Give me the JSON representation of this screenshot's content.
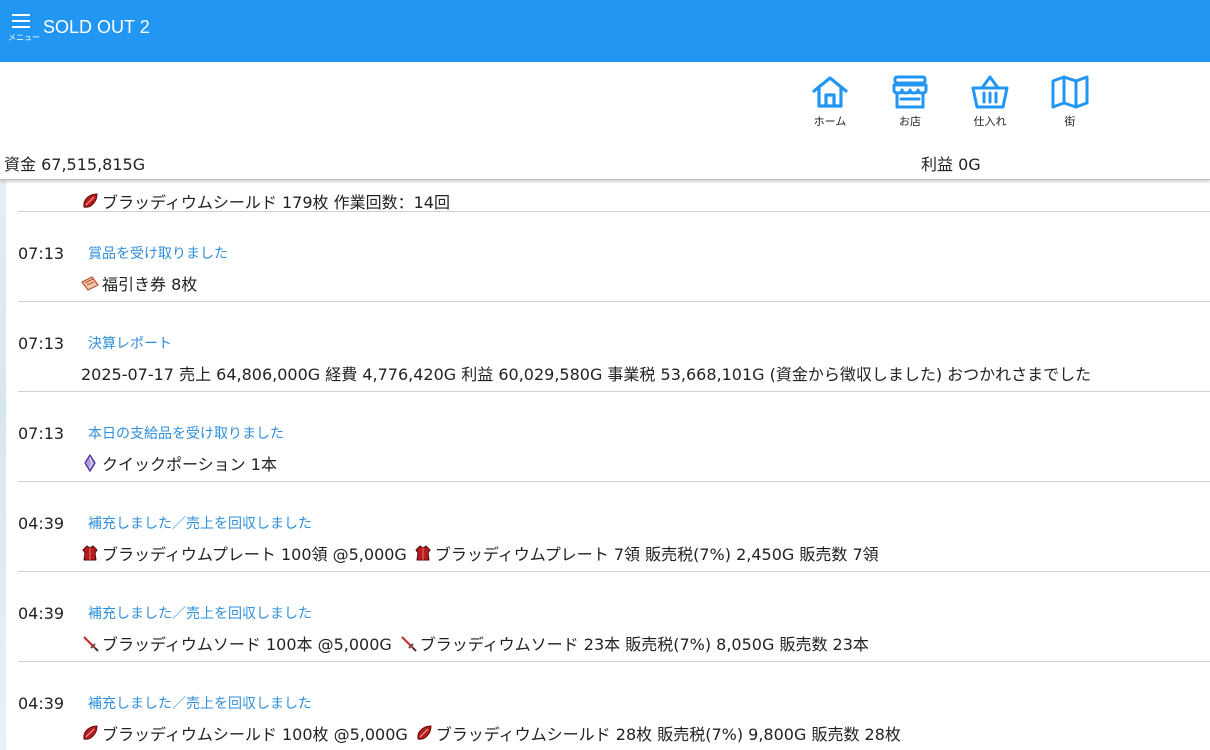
{
  "app": {
    "title": "SOLD OUT 2",
    "menu_caption": "メニュー",
    "accent_color": "#2196f3"
  },
  "nav": [
    {
      "label": "ホーム",
      "icon": "home-icon"
    },
    {
      "label": "お店",
      "icon": "shop-icon"
    },
    {
      "label": "仕入れ",
      "icon": "basket-icon"
    },
    {
      "label": "街",
      "icon": "map-icon"
    }
  ],
  "status": {
    "funds": "資金 67,515,815G",
    "profit": "利益 0G"
  },
  "log": [
    {
      "time": "",
      "title": "",
      "detail": [
        {
          "icon": "shield-icon",
          "text": "ブラッディウムシールド 179枚 作業回数：14回"
        }
      ]
    },
    {
      "time": "07:13",
      "title": "賞品を受け取りました",
      "detail": [
        {
          "icon": "ticket-icon",
          "text": "福引き券 8枚"
        }
      ]
    },
    {
      "time": "07:13",
      "title": "決算レポート",
      "detail": [
        {
          "icon": "",
          "text": "2025-07-17 売上 64,806,000G 経費 4,776,420G 利益 60,029,580G 事業税 53,668,101G (資金から徴収しました) おつかれさまでした"
        }
      ]
    },
    {
      "time": "07:13",
      "title": "本日の支給品を受け取りました",
      "detail": [
        {
          "icon": "potion-icon",
          "text": "クイックポーション 1本"
        }
      ]
    },
    {
      "time": "04:39",
      "title": "補充しました／売上を回収しました",
      "detail": [
        {
          "icon": "armor-icon",
          "text": "ブラッディウムプレート 100領 @5,000G"
        },
        {
          "icon": "armor-icon",
          "text": "ブラッディウムプレート 7領 販売税(7%) 2,450G 販売数 7領"
        }
      ]
    },
    {
      "time": "04:39",
      "title": "補充しました／売上を回収しました",
      "detail": [
        {
          "icon": "sword-icon",
          "text": "ブラッディウムソード 100本 @5,000G"
        },
        {
          "icon": "sword-icon",
          "text": "ブラッディウムソード 23本 販売税(7%) 8,050G 販売数 23本"
        }
      ]
    },
    {
      "time": "04:39",
      "title": "補充しました／売上を回収しました",
      "detail": [
        {
          "icon": "shield-icon",
          "text": "ブラッディウムシールド 100枚 @5,000G"
        },
        {
          "icon": "shield-icon",
          "text": "ブラッディウムシールド 28枚 販売税(7%) 9,800G 販売数 28枚"
        }
      ]
    }
  ]
}
